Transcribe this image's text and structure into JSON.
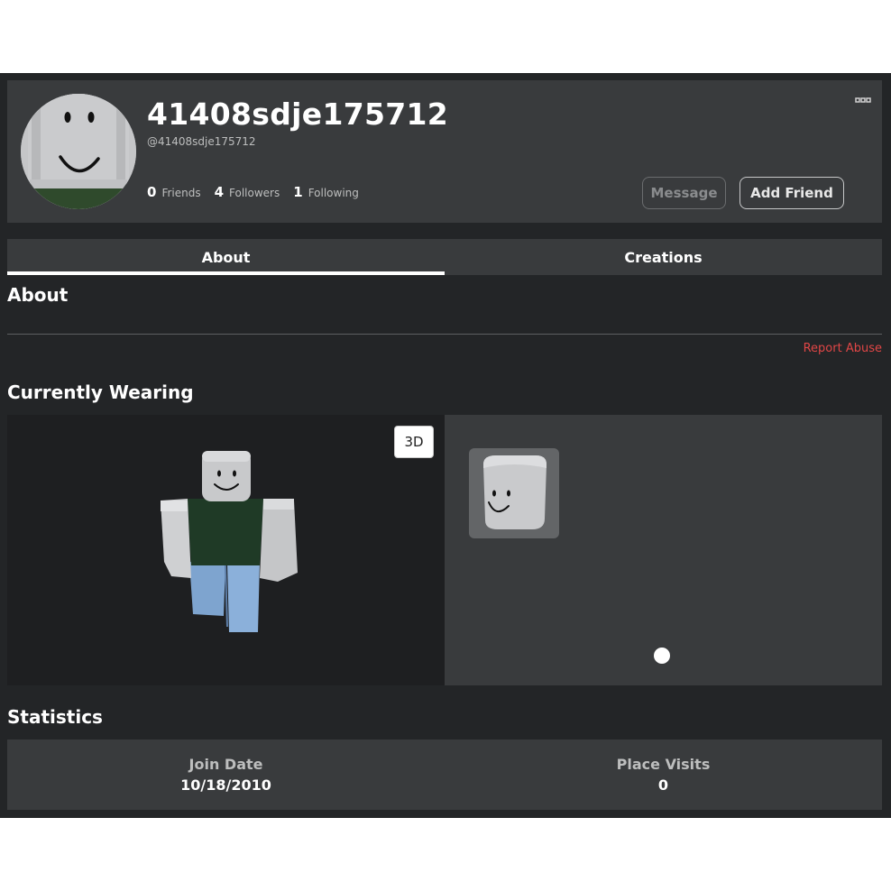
{
  "profile": {
    "display_name": "41408sdje175712",
    "username": "@41408sdje175712",
    "friends_count": "0",
    "friends_label": "Friends",
    "followers_count": "4",
    "followers_label": "Followers",
    "following_count": "1",
    "following_label": "Following",
    "message_label": "Message",
    "add_friend_label": "Add Friend",
    "more_icon": "ellipsis-icon"
  },
  "tabs": [
    {
      "label": "About",
      "active": true
    },
    {
      "label": "Creations",
      "active": false
    }
  ],
  "about": {
    "title": "About",
    "report_abuse_label": "Report Abuse"
  },
  "wearing": {
    "title": "Currently Wearing",
    "view_toggle_label": "3D",
    "items": [
      {
        "icon": "smiley-head-icon"
      }
    ]
  },
  "statistics": {
    "title": "Statistics",
    "join_date_label": "Join Date",
    "join_date_value": "10/18/2010",
    "place_visits_label": "Place Visits",
    "place_visits_value": "0"
  },
  "colors": {
    "page_bg": "#232527",
    "card_bg": "#393b3d",
    "report_abuse": "#e04646"
  }
}
